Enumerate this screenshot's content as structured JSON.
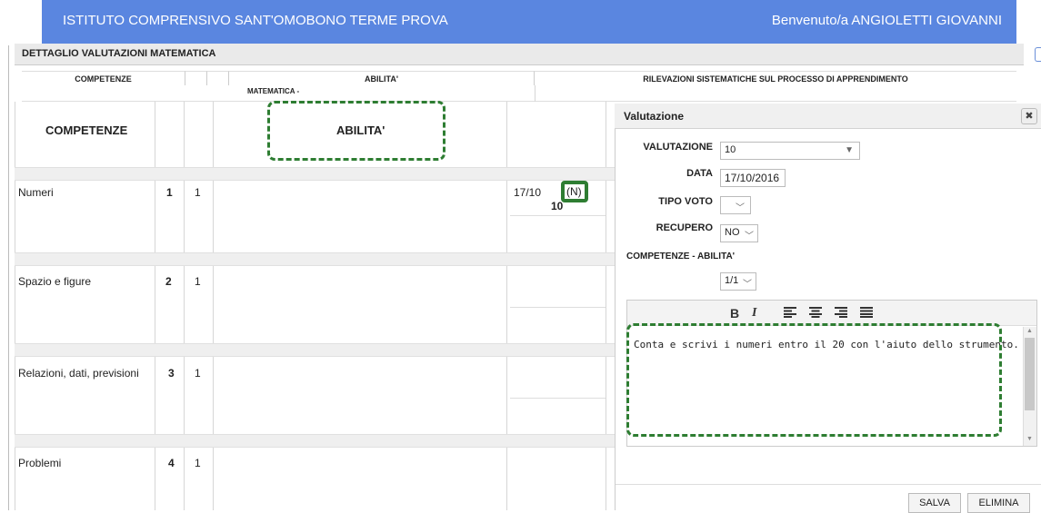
{
  "header": {
    "school": "ISTITUTO COMPRENSIVO SANT'OMOBONO TERME PROVA",
    "welcome": "Benvenuto/a ANGIOLETTI GIOVANNI"
  },
  "panel": {
    "title": "DETTAGLIO VALUTAZIONI MATEMATICA",
    "col_competenze": "COMPETENZE",
    "col_abilita": "ABILITA'",
    "col_rilevazioni": "RILEVAZIONI SISTEMATICHE SUL PROCESSO DI APPRENDIMENTO",
    "subject": "MATEMATICA -"
  },
  "grid": {
    "head_competenze": "COMPETENZE",
    "head_abilita": "ABILITA'",
    "rows": [
      {
        "label": "Numeri",
        "n": "1",
        "m": "1",
        "date": "17/10",
        "tag": "(N)",
        "grade": "10"
      },
      {
        "label": "Spazio e figure",
        "n": "2",
        "m": "1"
      },
      {
        "label": "Relazioni, dati, previsioni",
        "n": "3",
        "m": "1"
      },
      {
        "label": "Problemi",
        "n": "4",
        "m": "1"
      }
    ]
  },
  "dialog": {
    "title": "Valutazione",
    "close_icon": "close-icon",
    "valutazione_label": "VALUTAZIONE",
    "valutazione_value": "10",
    "data_label": "DATA",
    "data_value": "17/10/2016",
    "tipo_label": "TIPO VOTO",
    "tipo_value": "",
    "recupero_label": "RECUPERO",
    "recupero_value": "NO",
    "comp_label": "COMPETENZE - ABILITA'",
    "comp_value": "1/1",
    "toolbar": {
      "bold": "B",
      "italic": "I"
    },
    "editor_text": "Conta e scrivi i numeri entro il 20 con l'aiuto dello strumento.",
    "save": "SALVA",
    "delete": "ELIMINA"
  }
}
